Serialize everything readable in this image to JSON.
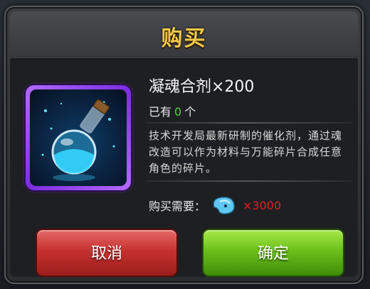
{
  "dialog": {
    "title": "购买",
    "item": {
      "name": "凝魂合剂×200",
      "owned_prefix": "已有",
      "owned_count": "0",
      "owned_suffix": "个",
      "description": "技术开发局最新研制的催化剂，通过魂改造可以作为材料与万能碎片合成任意角色的碎片。",
      "icon": "potion-flask-icon"
    },
    "cost": {
      "label": "购买需要：",
      "currency_icon": "soul-currency-icon",
      "amount": "×3000"
    },
    "buttons": {
      "cancel": "取消",
      "confirm": "确定"
    },
    "colors": {
      "title": "#f2c84a",
      "owned_count": "#4cd43c",
      "cost_amount": "#e0221c",
      "item_frame": "#9a4cf0",
      "cancel": "#c7312f",
      "confirm": "#6cc01a"
    }
  }
}
